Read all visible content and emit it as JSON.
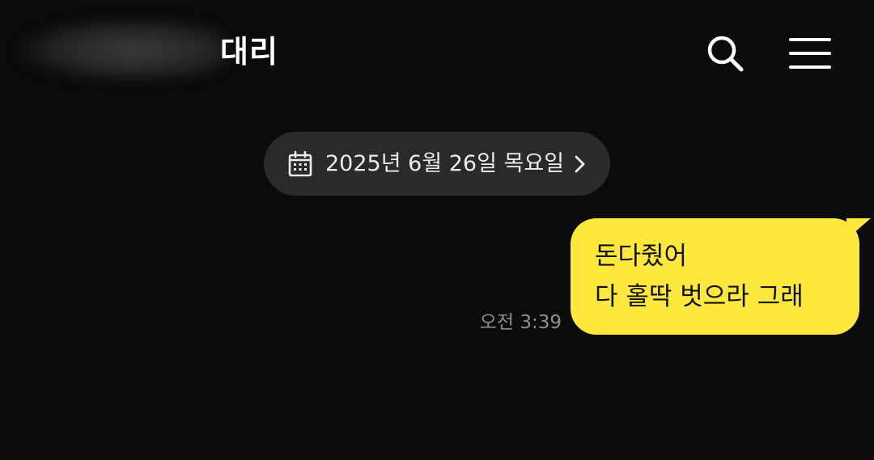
{
  "header": {
    "chat_title": "대리",
    "search_icon": "search-icon",
    "menu_icon": "hamburger-menu-icon"
  },
  "date_divider": {
    "label": "2025년 6월 26일 목요일",
    "icon": "calendar-icon",
    "chevron": "chevron-right-icon"
  },
  "messages": [
    {
      "sender": "me",
      "lines": [
        "돈다줬어",
        "다 홀딱 벗으라 그래"
      ],
      "time": "오전 3:39"
    }
  ],
  "colors": {
    "background": "#0b0b0c",
    "my_bubble": "#fee83d",
    "date_pill": "#2a2a2b",
    "timestamp": "#8e8e8e"
  }
}
